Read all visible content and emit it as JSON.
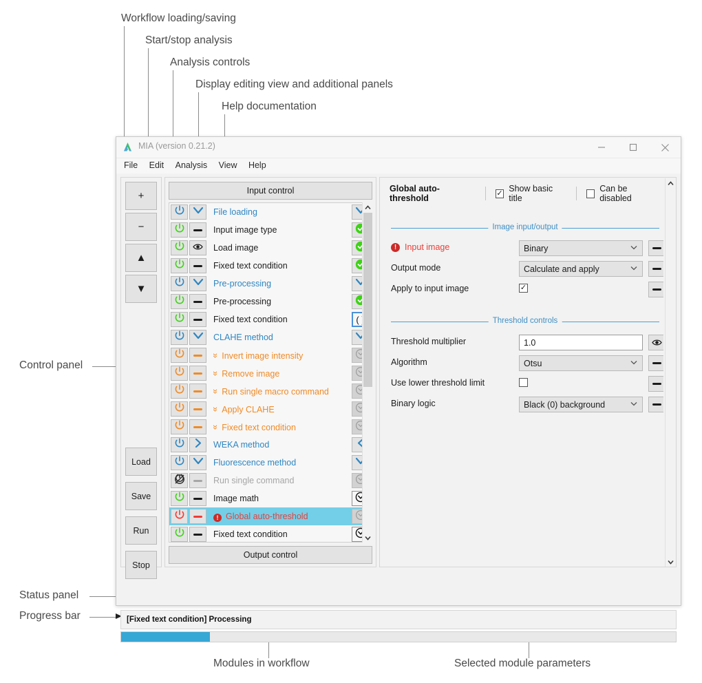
{
  "annotations": {
    "top": [
      {
        "text": "Workflow loading/saving"
      },
      {
        "text": "Start/stop analysis"
      },
      {
        "text": "Analysis controls"
      },
      {
        "text": "Display editing view and additional panels"
      },
      {
        "text": "Help documentation"
      }
    ],
    "left": [
      {
        "text": "Control panel"
      },
      {
        "text": "Status panel"
      },
      {
        "text": "Progress bar"
      }
    ],
    "bottom": [
      {
        "text": "Modules in workflow"
      },
      {
        "text": "Selected module parameters"
      }
    ]
  },
  "window": {
    "title": "MIA (version 0.21.2)",
    "logo_icon": "mia-logo-icon",
    "controls": {
      "minimize": "—",
      "maximize": "☐",
      "close": "✕"
    },
    "menu": [
      {
        "label": "File"
      },
      {
        "label": "Edit"
      },
      {
        "label": "Analysis"
      },
      {
        "label": "View"
      },
      {
        "label": "Help"
      }
    ]
  },
  "control_panel": {
    "top_buttons": [
      {
        "label": "+",
        "name": "add-module-button"
      },
      {
        "label": "−",
        "name": "remove-module-button"
      },
      {
        "label": "▲",
        "name": "move-module-up-button"
      },
      {
        "label": "▼",
        "name": "move-module-down-button"
      }
    ],
    "bottom_buttons": [
      {
        "label": "Load",
        "name": "load-button"
      },
      {
        "label": "Save",
        "name": "save-button"
      },
      {
        "label": "Run",
        "name": "run-button"
      },
      {
        "label": "Stop",
        "name": "stop-button"
      }
    ]
  },
  "module_panel": {
    "input_control_label": "Input control",
    "output_control_label": "Output control",
    "scrollbar": {
      "up": "▲",
      "down": "▼",
      "thumb_top_pct": 3,
      "thumb_height_pct": 52
    },
    "modules": [
      {
        "label": "File loading",
        "color": "blue",
        "power": "blue",
        "mid": "chevron-down",
        "state": "chevron-down"
      },
      {
        "label": "Input image type",
        "color": "black",
        "power": "green",
        "mid": "dash",
        "state": "green-check"
      },
      {
        "label": "Load image",
        "color": "black",
        "power": "green",
        "mid": "eye",
        "state": "green-check"
      },
      {
        "label": "Fixed text condition",
        "color": "black",
        "power": "green",
        "mid": "dash",
        "state": "green-check"
      },
      {
        "label": "Pre-processing",
        "color": "blue",
        "power": "blue",
        "mid": "chevron-down",
        "state": "chevron-down"
      },
      {
        "label": "Pre-processing",
        "color": "black",
        "power": "green",
        "mid": "dash",
        "state": "green-check"
      },
      {
        "label": "Fixed text condition",
        "color": "black",
        "power": "green",
        "mid": "dash",
        "state": "parens"
      },
      {
        "label": "CLAHE method",
        "color": "blue",
        "power": "blue",
        "mid": "chevron-down",
        "state": "chevron-down"
      },
      {
        "label": "Invert image intensity",
        "color": "orange",
        "power": "orange",
        "mid": "dash-orange",
        "state": "dim-circle",
        "indent": true
      },
      {
        "label": "Remove image",
        "color": "orange",
        "power": "orange",
        "mid": "dash-orange",
        "state": "dim-circle",
        "indent": true
      },
      {
        "label": "Run single macro command",
        "color": "orange",
        "power": "orange",
        "mid": "dash-orange",
        "state": "dim-circle",
        "indent": true
      },
      {
        "label": "Apply CLAHE",
        "color": "orange",
        "power": "orange",
        "mid": "dash-orange",
        "state": "dim-circle",
        "indent": true
      },
      {
        "label": "Fixed text condition",
        "color": "orange",
        "power": "orange",
        "mid": "dash-orange",
        "state": "dim-circle",
        "indent": true
      },
      {
        "label": "WEKA method",
        "color": "blue",
        "power": "blue",
        "mid": "chevron-right",
        "state": "chevron-left"
      },
      {
        "label": "Fluorescence method",
        "color": "blue",
        "power": "blue",
        "mid": "chevron-down",
        "state": "chevron-down"
      },
      {
        "label": "Run single command",
        "color": "grey",
        "power": "disabled",
        "mid": "dash-grey",
        "state": "dim-circle"
      },
      {
        "label": "Image math",
        "color": "black",
        "power": "green",
        "mid": "dash",
        "state": "circle-chevron"
      },
      {
        "label": "Global auto-threshold",
        "color": "red",
        "power": "red",
        "mid": "dash-red",
        "state": "dim-circle",
        "selected": true,
        "error": true
      },
      {
        "label": "Fixed text condition",
        "color": "black",
        "power": "green",
        "mid": "dash",
        "state": "circle-chevron"
      }
    ]
  },
  "param_panel": {
    "title": "Global auto-threshold",
    "show_basic_title": {
      "label": "Show basic title",
      "checked": true
    },
    "can_be_disabled": {
      "label": "Can be disabled",
      "checked": false
    },
    "scrollbar": {
      "up": "▲",
      "down": "▼"
    },
    "sections": [
      {
        "title": "Image input/output",
        "rows": [
          {
            "name": "Input image",
            "type": "combo",
            "value": "Binary",
            "required": true,
            "button": "dash"
          },
          {
            "name": "Output mode",
            "type": "combo",
            "value": "Calculate and apply",
            "required": false,
            "button": "dash"
          },
          {
            "name": "Apply to input image",
            "type": "checkbox",
            "checked": true,
            "required": false,
            "button": "dash"
          }
        ]
      },
      {
        "title": "Threshold controls",
        "rows": [
          {
            "name": "Threshold multiplier",
            "type": "text",
            "value": "1.0",
            "required": false,
            "button": "eye"
          },
          {
            "name": "Algorithm",
            "type": "combo",
            "value": "Otsu",
            "required": false,
            "button": "dash"
          },
          {
            "name": "Use lower threshold limit",
            "type": "checkbox",
            "checked": false,
            "required": false,
            "button": "dash"
          },
          {
            "name": "Binary logic",
            "type": "combo",
            "value": "Black (0) background",
            "required": false,
            "button": "dash"
          }
        ]
      }
    ]
  },
  "status": {
    "text": "[Fixed text condition] Processing",
    "progress_percent": 16,
    "progress_color": "#35a8d6"
  },
  "colors": {
    "accent_blue": "#2e86c1",
    "selection": "#73cfe8",
    "green": "#3fd217",
    "orange": "#f08a25",
    "red": "#e8403a",
    "progress": "#35a8d6"
  }
}
